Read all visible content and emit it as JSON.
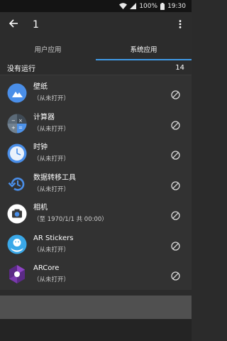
{
  "status": {
    "battery": "100%",
    "time": "19:30"
  },
  "appbar": {
    "title": "1"
  },
  "tabs": [
    {
      "label": "用户应用",
      "active": false
    },
    {
      "label": "系统应用",
      "active": true
    }
  ],
  "section": {
    "label": "没有运行",
    "count": "14"
  },
  "apps": [
    {
      "name": "壁纸",
      "sub": "（从未打开）",
      "icon": "wallpaper-icon"
    },
    {
      "name": "计算器",
      "sub": "（从未打开）",
      "icon": "calculator-icon"
    },
    {
      "name": "时钟",
      "sub": "（从未打开）",
      "icon": "clock-icon"
    },
    {
      "name": "数据转移工具",
      "sub": "（从未打开）",
      "icon": "data-transfer-icon"
    },
    {
      "name": "相机",
      "sub": "（至 1970/1/1 共 00:00）",
      "icon": "camera-icon"
    },
    {
      "name": "AR Stickers",
      "sub": "（从未打开）",
      "icon": "ar-stickers-icon"
    },
    {
      "name": "ARCore",
      "sub": "（从未打开）",
      "icon": "arcore-icon"
    }
  ],
  "colors": {
    "accent": "#3f9ae6",
    "background": "#2b2b2b",
    "list": "#323232"
  }
}
